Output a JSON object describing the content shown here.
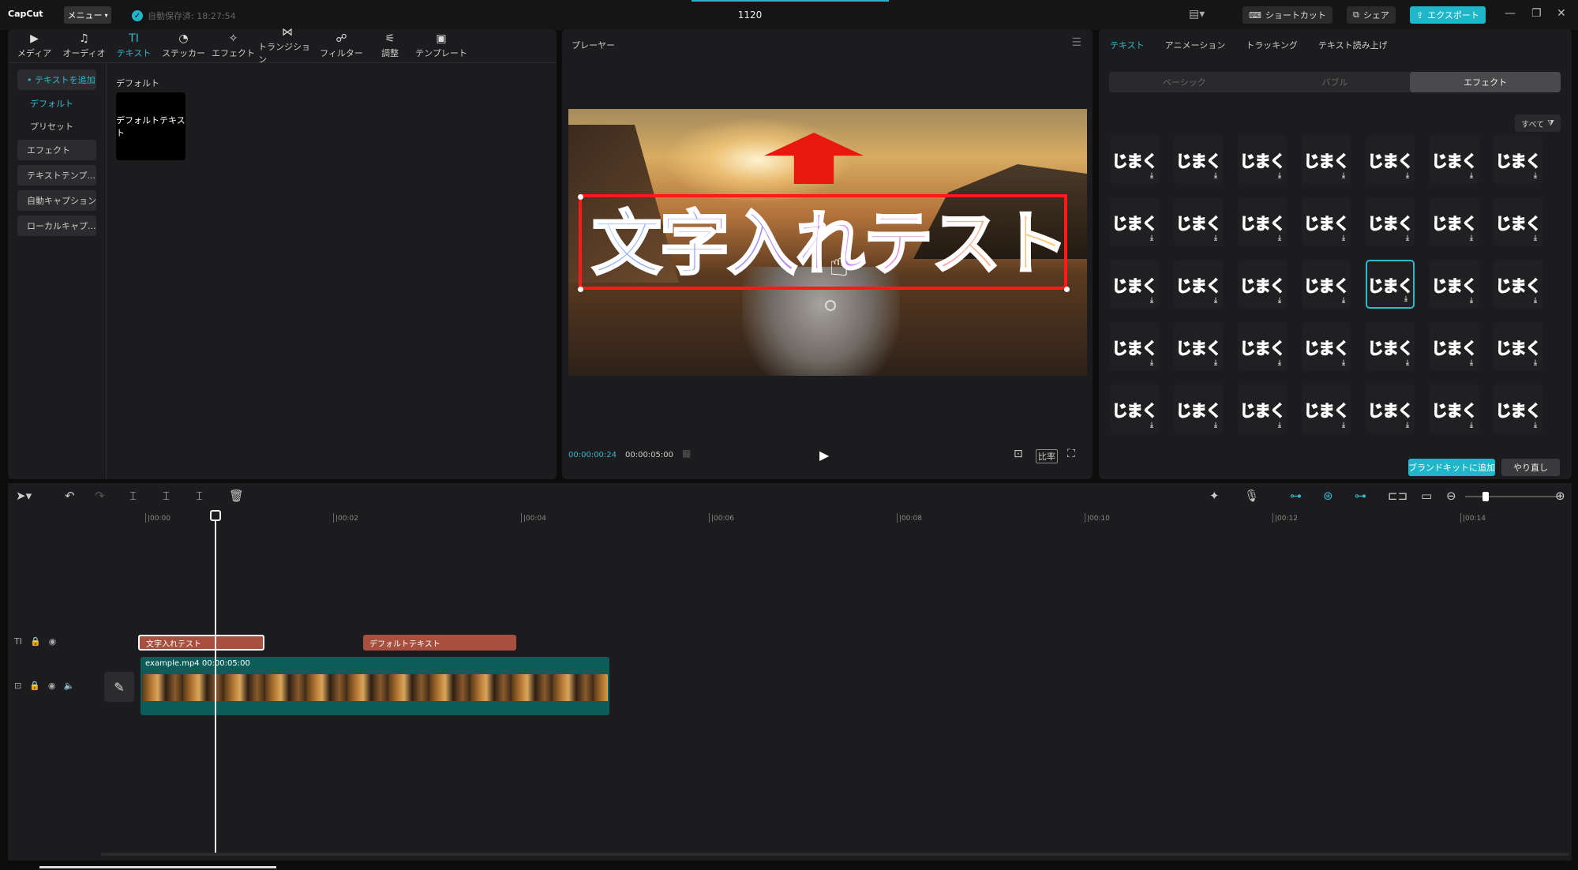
{
  "titlebar": {
    "logo": "CapCut",
    "menu_label": "メニュー",
    "autosave": "自動保存済: 18:27:54",
    "project_title": "1120",
    "shortcut_label": "ショートカット",
    "share_label": "シェア",
    "export_label": "エクスポート"
  },
  "toolbar": {
    "items": [
      {
        "label": "メディア",
        "icon": "media-icon"
      },
      {
        "label": "オーディオ",
        "icon": "audio-icon"
      },
      {
        "label": "テキスト",
        "icon": "text-icon"
      },
      {
        "label": "ステッカー",
        "icon": "sticker-icon"
      },
      {
        "label": "エフェクト",
        "icon": "effect-icon"
      },
      {
        "label": "トランジション",
        "icon": "transition-icon"
      },
      {
        "label": "フィルター",
        "icon": "filter-icon"
      },
      {
        "label": "調整",
        "icon": "adjust-icon"
      },
      {
        "label": "テンプレート",
        "icon": "template-icon"
      }
    ]
  },
  "sidebar": {
    "items": [
      "• テキストを追加",
      "デフォルト",
      "プリセット",
      "エフェクト",
      "テキストテンプ...",
      "自動キャプション",
      "ローカルキャプ..."
    ]
  },
  "text_library": {
    "section": "デフォルト",
    "tile_label": "デフォルトテキスト"
  },
  "player": {
    "title": "プレーヤー",
    "overlay_text": "文字入れテスト",
    "current_time": "00:00:00:24",
    "duration": "00:00:05:00",
    "ratio_label": "比率"
  },
  "right_panel": {
    "tabs": [
      "テキスト",
      "アニメーション",
      "トラッキング",
      "テキスト読み上げ"
    ],
    "segments": [
      "ベーシック",
      "バブル",
      "エフェクト"
    ],
    "filter_label": "すべて",
    "effect_text": "じまく",
    "effect_colors": [
      "#b0b8d8",
      "#ffffff",
      "#ffe8f0",
      "#ffb36a",
      "#ff7ab6",
      "#ffffff",
      "#ffffff",
      "#ff6ea0",
      "#ffffff",
      "#c8a0ff",
      "#ff5aa8",
      "#ffe08a",
      "#ff6ea0",
      "#ff4fb0",
      "#c690ff",
      "#ff7a6a",
      "#ffd6a0",
      "#ff90b0",
      "#ffe46a",
      "#b890ff",
      "#d0a0ff",
      "#9ab8ff",
      "#88a8ff",
      "#b0a0ff",
      "#ffd0f0",
      "#ff5ad0",
      "#ff80b0",
      "#ffffff",
      "#ff5ab8",
      "#8890ff",
      "#ff70a0",
      "#ff5aa8",
      "#ff3aa0",
      "#ffd0e8",
      "#ffffff"
    ],
    "brand_kit_label": "ブランドキットに追加",
    "reset_label": "やり直し"
  },
  "timeline": {
    "ruler": [
      "|00:00",
      "|00:02",
      "|00:04",
      "|00:06",
      "|00:08",
      "|00:10",
      "|00:12",
      "|00:14"
    ],
    "text_clip_1": "文字入れテスト",
    "text_clip_2": "デフォルトテキスト",
    "video_clip_label": "example.mp4   00:00:05:00"
  },
  "colors": {
    "accent": "#2fb9cc",
    "panel": "#1c1c1e",
    "text_clip": "#a94f3f",
    "video_clip": "#0c5c5a",
    "overlay_border": "#ff1a1a"
  }
}
